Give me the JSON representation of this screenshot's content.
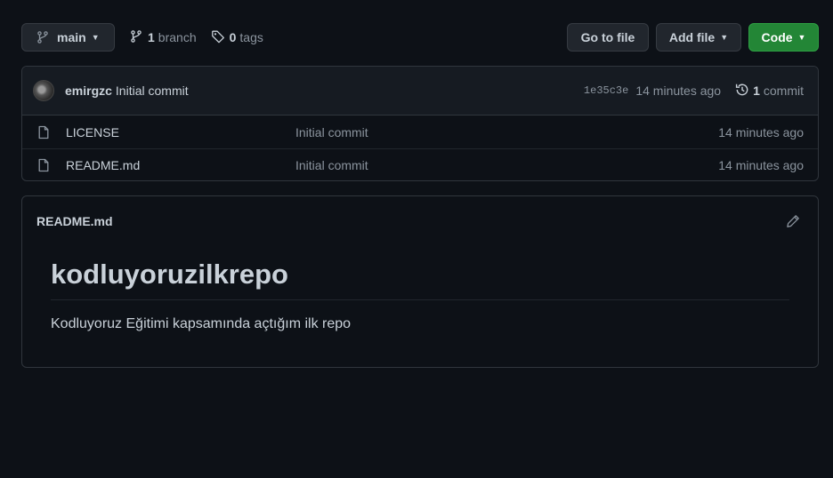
{
  "toolbar": {
    "branch_label": "main",
    "branch_count": "1",
    "branch_word": "branch",
    "tag_count": "0",
    "tag_word": "tags",
    "goto_file_label": "Go to file",
    "add_file_label": "Add file",
    "code_label": "Code"
  },
  "latest_commit": {
    "author": "emirgzc",
    "message": "Initial commit",
    "sha": "1e35c3e",
    "time": "14 minutes ago",
    "commit_count": "1",
    "commit_word": "commit"
  },
  "files": [
    {
      "name": "LICENSE",
      "message": "Initial commit",
      "age": "14 minutes ago",
      "icon": "file-icon"
    },
    {
      "name": "README.md",
      "message": "Initial commit",
      "age": "14 minutes ago",
      "icon": "file-icon"
    }
  ],
  "readme": {
    "filename": "README.md",
    "heading": "kodluyoruzilkrepo",
    "paragraph": "Kodluyoruz Eğitimi kapsamında açtığım ilk repo"
  },
  "colors": {
    "background": "#0d1117",
    "code_button": "#238636",
    "border": "#30363d"
  }
}
